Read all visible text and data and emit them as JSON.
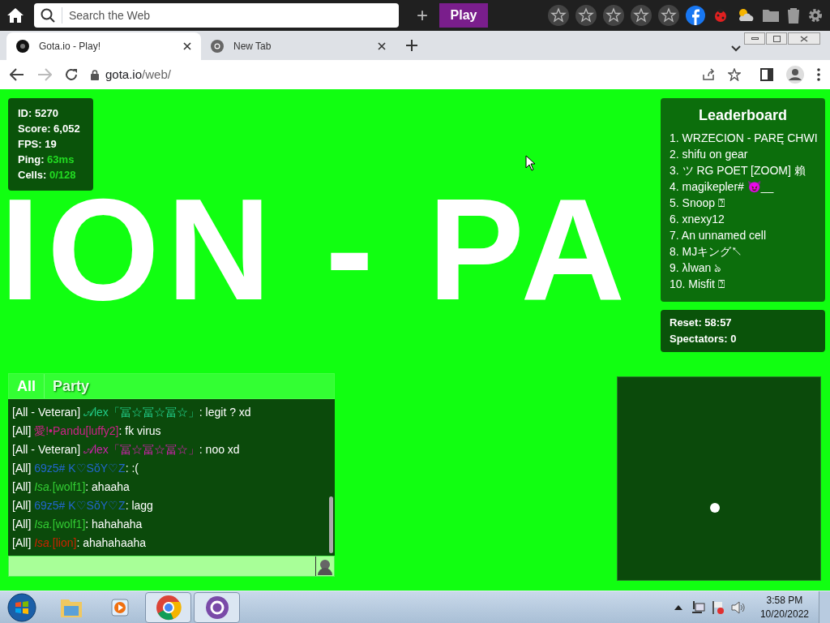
{
  "top_toolbar": {
    "search_placeholder": "Search the Web",
    "add_label": "+",
    "play_label": "Play"
  },
  "tabs": [
    {
      "title": "Gota.io - Play!",
      "selected": true
    },
    {
      "title": "New Tab",
      "selected": false
    }
  ],
  "address_bar": {
    "host": "gota.io",
    "path": "/web/"
  },
  "game": {
    "background_text": "ION - PA",
    "stats": [
      {
        "label": "ID:",
        "value": "5270",
        "highlight": false
      },
      {
        "label": "Score:",
        "value": "6,052",
        "highlight": false
      },
      {
        "label": "FPS:",
        "value": "19",
        "highlight": false
      },
      {
        "label": "Ping:",
        "value": "63ms",
        "highlight": true
      },
      {
        "label": "Cells:",
        "value": "0/128",
        "highlight": true
      }
    ],
    "leaderboard": {
      "title": "Leaderboard",
      "entries": [
        "1. WRZECION - PARĘ CHWI",
        "2. shifu on gear",
        "3. ツ RG POET [ZOOM] 賴",
        "4. magikepler# 😈__",
        "5. Snoop ⍰",
        "6. xnexy12",
        "7. An unnamed cell",
        "8. MJキング↖",
        "9. λlwan ঌ",
        "10. Misfit ⍰"
      ]
    },
    "server_info": [
      "Reset: 58:57",
      "Spectators: 0"
    ],
    "chat": {
      "tabs": [
        {
          "label": "All",
          "selected": true
        },
        {
          "label": "Party",
          "selected": false
        }
      ],
      "messages": [
        {
          "prefix": "[All - Veteran]",
          "name": "𝒜lex「冨☆冨☆冨☆」",
          "color": "#22cc88",
          "message": ": legit ? xd"
        },
        {
          "prefix": "[All]",
          "name": "愛!•Pandu[luffy2]",
          "color": "#cc2288",
          "message": ": fk virus"
        },
        {
          "prefix": "[All - Veteran]",
          "name": "𝒜lex「冨☆冨☆冨☆」",
          "color": "#cc22aa",
          "message": ": noo xd"
        },
        {
          "prefix": "[All]",
          "name": "69z5# K♡SŏY♡Z",
          "color": "#2266cc",
          "message": ": :("
        },
        {
          "prefix": "[All]",
          "name": "*Isa.*[wolf1]",
          "color": "#33cc33",
          "message": ": ahaaha"
        },
        {
          "prefix": "[All]",
          "name": "69z5# K♡SŏY♡Z",
          "color": "#2266cc",
          "message": ": lagg"
        },
        {
          "prefix": "[All]",
          "name": "*Isa.*[wolf1]",
          "color": "#33cc33",
          "message": ": hahahaha"
        },
        {
          "prefix": "[All]",
          "name": "*Isa.*[lion]",
          "color": "#cc2200",
          "message": ": ahahahaaha"
        }
      ]
    }
  },
  "taskbar": {
    "apps": [
      {
        "kind": "explorer",
        "active": false
      },
      {
        "kind": "media",
        "active": false
      },
      {
        "kind": "chrome",
        "active": true
      },
      {
        "kind": "app",
        "active": true
      }
    ],
    "time": "3:58 PM",
    "date": "10/20/2022"
  }
}
